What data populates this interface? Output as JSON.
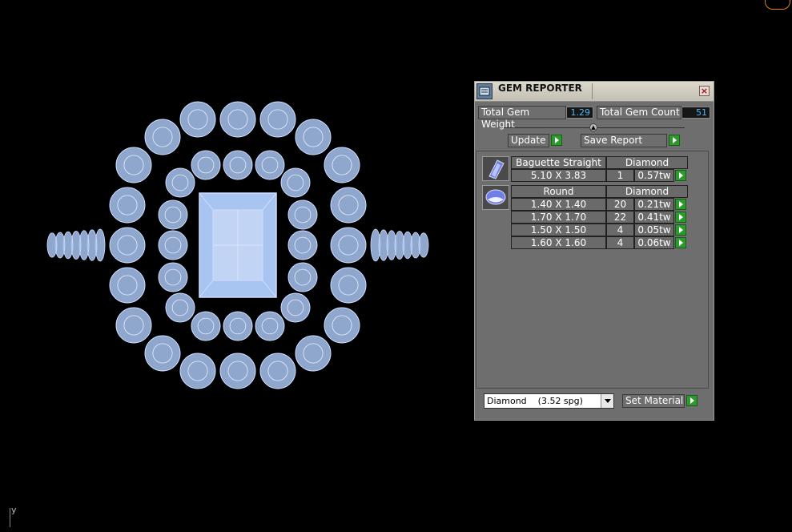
{
  "panel": {
    "title": "GEM REPORTER",
    "close_symbol": "×",
    "total_weight_label": "Total Gem Weight",
    "total_weight_value": "1.29",
    "total_count_label": "Total Gem Count",
    "total_count_value": "51",
    "update_label": "Update",
    "save_report_label": "Save Report",
    "groups": [
      {
        "icon": "baguette-gem-icon",
        "shape": "Baguette Straight",
        "material": "Diamond",
        "rows": [
          {
            "size": "5.10 X 3.83",
            "count": "1",
            "weight": "0.57tw"
          }
        ]
      },
      {
        "icon": "round-gem-icon",
        "shape": "Round",
        "material": "Diamond",
        "rows": [
          {
            "size": "1.40 X 1.40",
            "count": "20",
            "weight": "0.21tw"
          },
          {
            "size": "1.70 X 1.70",
            "count": "22",
            "weight": "0.41tw"
          },
          {
            "size": "1.50 X 1.50",
            "count": "4",
            "weight": "0.05tw"
          },
          {
            "size": "1.60 X 1.60",
            "count": "4",
            "weight": "0.06tw"
          }
        ]
      }
    ],
    "material_select_value": "Diamond    (3.52 spg)",
    "set_material_label": "Set Material"
  },
  "viewport": {
    "axis_label": "y",
    "gem_color": "#a8c4f0",
    "wire_color": "#cfdcff"
  },
  "colors": {
    "accent_green": "#2e9a2e",
    "value_blue": "#4fb6ee"
  }
}
